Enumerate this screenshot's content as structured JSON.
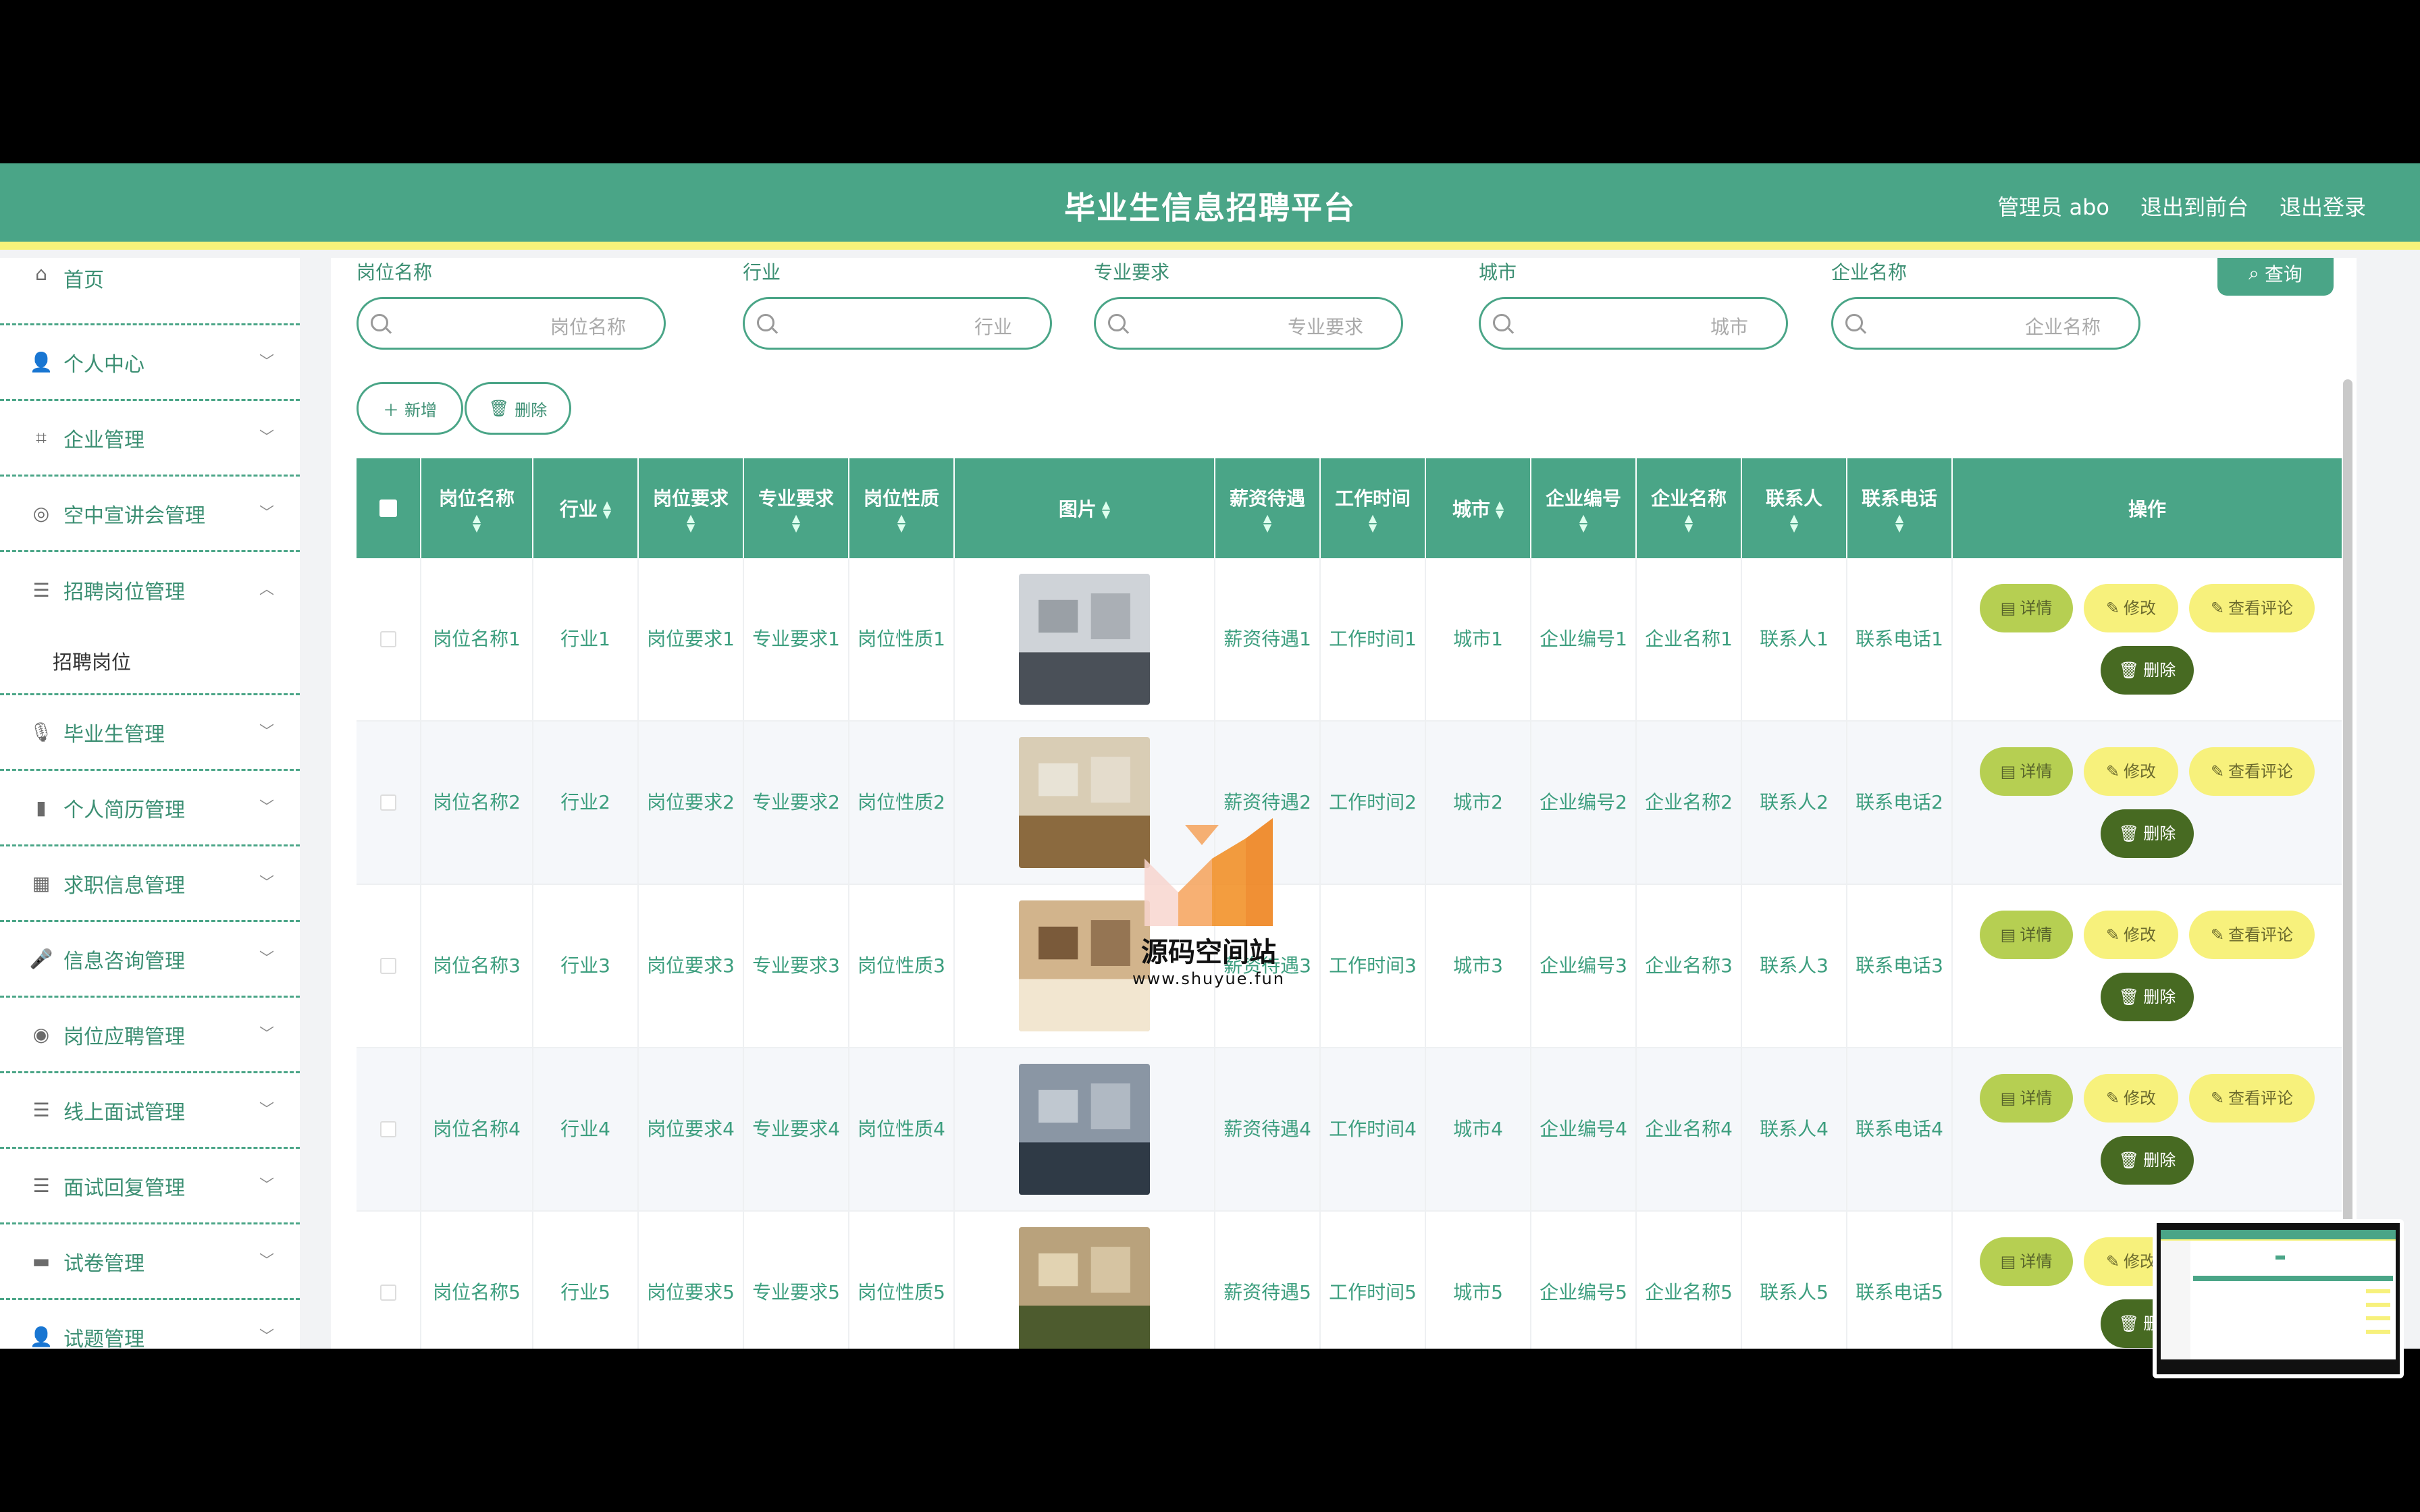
{
  "header": {
    "title": "毕业生信息招聘平台",
    "nav": [
      "管理员 abo",
      "退出到前台",
      "退出登录"
    ]
  },
  "sidebar": {
    "items": [
      {
        "label": "首页",
        "icon": "home-icon"
      },
      {
        "label": "个人中心",
        "icon": "user-icon"
      },
      {
        "label": "企业管理",
        "icon": "crop-icon"
      },
      {
        "label": "空中宣讲会管理",
        "icon": "aperture-icon"
      },
      {
        "label": "招聘岗位管理",
        "icon": "sliders-icon"
      },
      {
        "label": "毕业生管理",
        "icon": "microphone-icon"
      },
      {
        "label": "个人简历管理",
        "icon": "bar-chart-icon"
      },
      {
        "label": "求职信息管理",
        "icon": "grid-icon"
      },
      {
        "label": "信息咨询管理",
        "icon": "mic-icon"
      },
      {
        "label": "岗位应聘管理",
        "icon": "gauge-icon"
      },
      {
        "label": "线上面试管理",
        "icon": "list-icon"
      },
      {
        "label": "面试回复管理",
        "icon": "list-icon"
      },
      {
        "label": "试卷管理",
        "icon": "monitor-icon"
      },
      {
        "label": "试题管理",
        "icon": "user-icon"
      }
    ],
    "submenu": "招聘岗位"
  },
  "search": {
    "fields": [
      {
        "label": "岗位名称",
        "placeholder": "岗位名称"
      },
      {
        "label": "行业",
        "placeholder": "行业"
      },
      {
        "label": "专业要求",
        "placeholder": "专业要求"
      },
      {
        "label": "城市",
        "placeholder": "城市"
      },
      {
        "label": "企业名称",
        "placeholder": "企业名称"
      }
    ],
    "query_label": "查询"
  },
  "actions": {
    "add": "新增",
    "delete": "删除"
  },
  "table": {
    "headers": [
      "岗位名称",
      "行业",
      "岗位要求",
      "专业要求",
      "岗位性质",
      "图片",
      "薪资待遇",
      "工作时间",
      "城市",
      "企业编号",
      "企业名称",
      "联系人",
      "联系电话",
      "操作"
    ],
    "rows": [
      [
        "岗位名称1",
        "行业1",
        "岗位要求1",
        "专业要求1",
        "岗位性质1",
        "薪资待遇1",
        "工作时间1",
        "城市1",
        "企业编号1",
        "企业名称1",
        "联系人1",
        "联系电话1"
      ],
      [
        "岗位名称2",
        "行业2",
        "岗位要求2",
        "专业要求2",
        "岗位性质2",
        "薪资待遇2",
        "工作时间2",
        "城市2",
        "企业编号2",
        "企业名称2",
        "联系人2",
        "联系电话2"
      ],
      [
        "岗位名称3",
        "行业3",
        "岗位要求3",
        "专业要求3",
        "岗位性质3",
        "薪资待遇3",
        "工作时间3",
        "城市3",
        "企业编号3",
        "企业名称3",
        "联系人3",
        "联系电话3"
      ],
      [
        "岗位名称4",
        "行业4",
        "岗位要求4",
        "专业要求4",
        "岗位性质4",
        "薪资待遇4",
        "工作时间4",
        "城市4",
        "企业编号4",
        "企业名称4",
        "联系人4",
        "联系电话4"
      ],
      [
        "岗位名称5",
        "行业5",
        "岗位要求5",
        "专业要求5",
        "岗位性质5",
        "薪资待遇5",
        "工作时间5",
        "城市5",
        "企业编号5",
        "企业名称5",
        "联系人5",
        "联系电话5"
      ]
    ],
    "ops": {
      "detail": "详情",
      "edit": "修改",
      "comment": "查看评论",
      "delete": "删除"
    }
  },
  "watermark": {
    "name": "源码空间站",
    "url": "www.shuyue.fun"
  },
  "colors": {
    "primary": "#4aa587",
    "accent_yellow": "#f6f27a",
    "detail": "#b6cf52",
    "delete": "#476a22"
  }
}
